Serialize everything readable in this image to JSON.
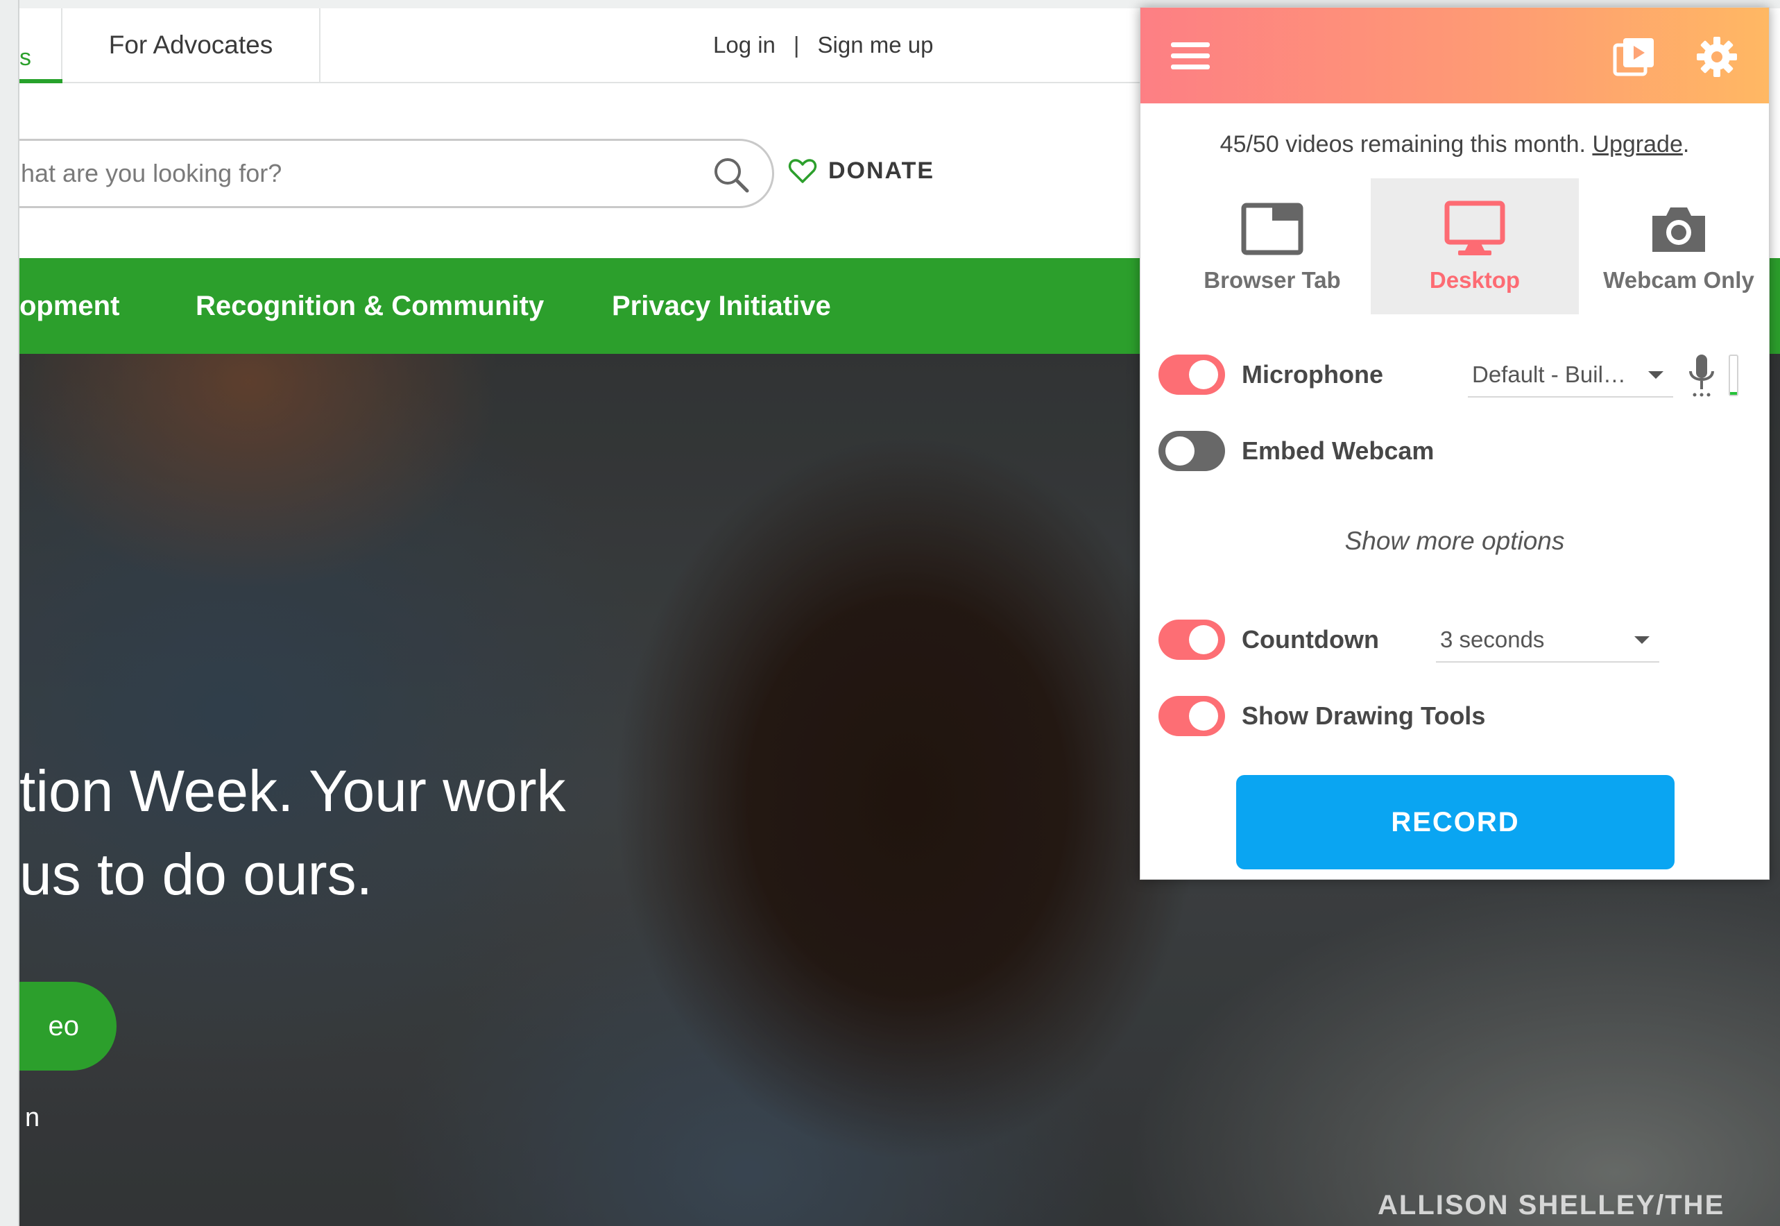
{
  "site": {
    "tab_cut_text": "s",
    "tab_advocates": "For Advocates",
    "login": "Log in",
    "auth_separator": "|",
    "signup": "Sign me up",
    "search_placeholder": "hat are you looking for?",
    "donate": "DONATE",
    "nav": [
      "opment",
      "Recognition & Community",
      "Privacy Initiative"
    ],
    "headline_line1": "tion Week. Your work",
    "headline_line2": "us to do ours.",
    "cta_fragment": "eo",
    "small_fragment": "n",
    "photo_credit": "ALLISON SHELLEY/THE",
    "accent_green": "#2c9f2c"
  },
  "popup": {
    "icons": [
      "menu-icon",
      "video-library-icon",
      "gear-icon"
    ],
    "quota_text": "45/50 videos remaining this month.",
    "upgrade_link": "Upgrade",
    "quota_period": ".",
    "modes": [
      {
        "label": "Browser Tab",
        "icon": "browser-tab-icon",
        "active": false
      },
      {
        "label": "Desktop",
        "icon": "desktop-icon",
        "active": true
      },
      {
        "label": "Webcam Only",
        "icon": "camera-icon",
        "active": false
      }
    ],
    "microphone": {
      "label": "Microphone",
      "on": true,
      "device": "Default - Buil…",
      "input_level": 0.08
    },
    "webcam": {
      "label": "Embed Webcam",
      "on": false
    },
    "more_options": "Show more options",
    "countdown": {
      "label": "Countdown",
      "on": true,
      "value": "3 seconds"
    },
    "drawing_tools": {
      "label": "Show Drawing Tools",
      "on": true
    },
    "record": "RECORD",
    "accent_color": "#fd6e74",
    "record_color": "#0aa5f2"
  }
}
